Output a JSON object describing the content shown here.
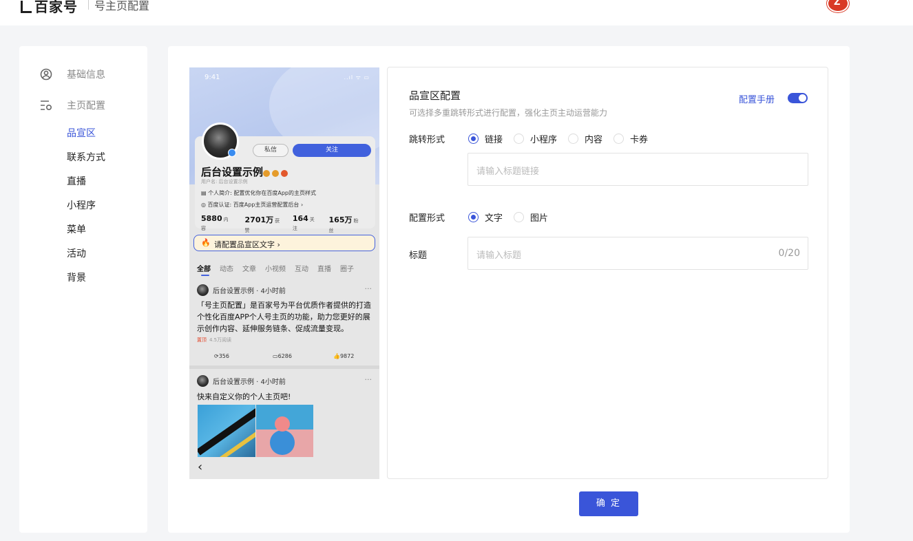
{
  "header": {
    "brand": "百家号",
    "page_title": "号主页配置",
    "avatar_letter": "Z"
  },
  "sidebar": {
    "group_basic": "基础信息",
    "group_home": "主页配置",
    "items": [
      "品宣区",
      "联系方式",
      "直播",
      "小程序",
      "菜单",
      "活动",
      "背景"
    ],
    "active_index": 0
  },
  "phone": {
    "time": "9:41",
    "status": "..ıl ᯤ ▭",
    "profile": {
      "name": "后台设置示例",
      "username": "用户名: 后台设置示例",
      "intro": "个人简介: 配置优化你在百度App的主页样式",
      "auth": "百度认证: 百度App主页运营配置后台",
      "msg_btn": "私信",
      "follow_btn": "关注",
      "stats": [
        {
          "value": "5880",
          "label": "内容"
        },
        {
          "value": "2701万",
          "label": "获赞"
        },
        {
          "value": "164",
          "label": "关注"
        },
        {
          "value": "165万",
          "label": "粉丝"
        }
      ]
    },
    "banner_text": "请配置品宣区文字",
    "tabs": [
      "全部",
      "动态",
      "文章",
      "小视频",
      "互动",
      "直播",
      "圈子"
    ],
    "post1": {
      "author": "后台设置示例 · 4小时前",
      "text": "「号主页配置」是百家号为平台优质作者提供的打造个性化百度APP个人号主页的功能，助力您更好的展示创作内容、延伸服务链条、促成流量变现。",
      "pin": "置顶",
      "reads": "4.5万阅读",
      "shares": "356",
      "comments": "6286",
      "likes": "9872"
    },
    "post2": {
      "author": "后台设置示例 · 4小时前",
      "text": "快来自定义你的个人主页吧!"
    }
  },
  "form": {
    "title": "品宣区配置",
    "subtitle": "可选择多重跳转形式进行配置，强化主页主动运营能力",
    "manual": "配置手册",
    "jump_label": "跳转形式",
    "jump_options": [
      "链接",
      "小程序",
      "内容",
      "卡券"
    ],
    "jump_selected": 0,
    "link_placeholder": "请输入标题链接",
    "style_label": "配置形式",
    "style_options": [
      "文字",
      "图片"
    ],
    "style_selected": 0,
    "title_label": "标题",
    "title_placeholder": "请输入标题",
    "title_count": "0/20",
    "confirm": "确 定"
  },
  "colors": {
    "accent": "#3a55d9",
    "banner_bg": "#fdf3dc"
  }
}
